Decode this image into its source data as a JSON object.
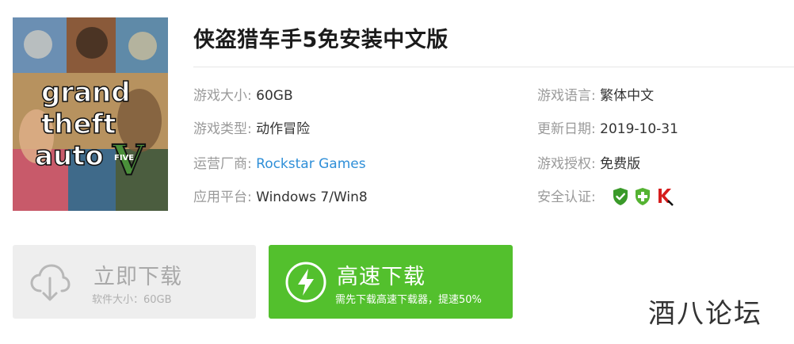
{
  "game": {
    "title": "侠盗猎车手5免安装中文版",
    "cover": {
      "logo_lines": [
        "grand",
        "theft",
        "auto"
      ],
      "logo_numeral": "V",
      "logo_badge": "FIVE"
    }
  },
  "info": {
    "size": {
      "label": "游戏大小:",
      "value": "60GB"
    },
    "type": {
      "label": "游戏类型:",
      "value": "动作冒险"
    },
    "publisher": {
      "label": "运营厂商:",
      "value": "Rockstar Games"
    },
    "platform": {
      "label": "应用平台:",
      "value": "Windows 7/Win8"
    },
    "language": {
      "label": "游戏语言:",
      "value": "繁体中文"
    },
    "update": {
      "label": "更新日期:",
      "value": "2019-10-31"
    },
    "license": {
      "label": "游戏授权:",
      "value": "免费版"
    },
    "security": {
      "label": "安全认证:",
      "badges": [
        "shield-check-icon",
        "shield-plus-icon",
        "kaspersky-k-icon"
      ]
    }
  },
  "buttons": {
    "normal": {
      "label": "立即下载",
      "sub": "软件大小：60GB"
    },
    "fast": {
      "label": "高速下载",
      "sub": "需先下载高速下载器，提速50%"
    }
  },
  "watermark": "酒八论坛",
  "colors": {
    "accent_green": "#53c02d",
    "link_blue": "#2f8fd8",
    "label_gray": "#9a9a9a",
    "button_gray": "#eeeeee"
  }
}
